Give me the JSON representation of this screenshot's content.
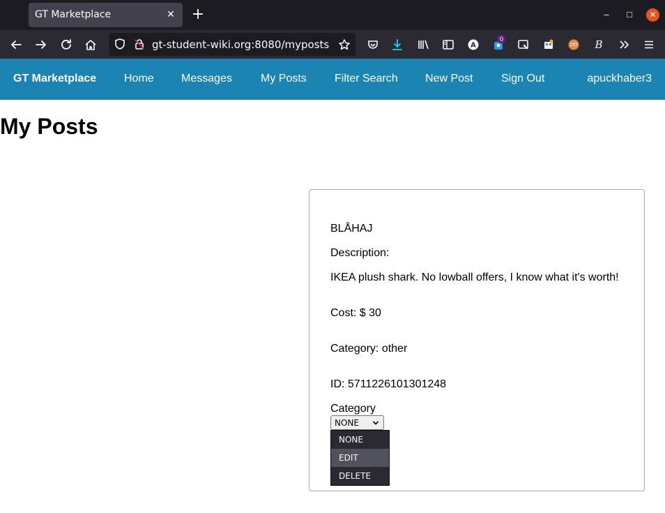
{
  "browser": {
    "tab_title": "GT Marketplace",
    "tab_close": "✕",
    "new_tab": "+",
    "url": "gt-student-wiki.org:8080/myposts",
    "extension_badge": "0",
    "window_controls": {
      "minimize": "–",
      "maximize": "□",
      "close": "✕"
    },
    "icons": [
      "back-icon",
      "forward-icon",
      "reload-icon",
      "home-icon",
      "shield-icon",
      "insecure-lock-icon",
      "bookmark-star-icon",
      "pocket-icon",
      "download-icon",
      "library-icon",
      "sidebar-icon",
      "account-icon",
      "extension-icon",
      "screenshot-icon",
      "extension-icon",
      "extension-icon",
      "extension-icon",
      "more-tools-icon",
      "menu-icon"
    ]
  },
  "site_nav": {
    "brand": "GT Marketplace",
    "links": [
      "Home",
      "Messages",
      "My Posts",
      "Filter Search",
      "New Post",
      "Sign Out"
    ],
    "user": "apuckhaber3"
  },
  "page": {
    "title": "My Posts"
  },
  "post": {
    "name": "BLÅHAJ",
    "description_label": "Description:",
    "description": "IKEA plush shark. No lowball offers, I know what it's worth!",
    "cost": "Cost: $ 30",
    "category": "Category: other",
    "id": "ID: 5711226101301248",
    "action_label": "Category",
    "select_value": "NONE",
    "options": [
      "NONE",
      "EDIT",
      "DELETE"
    ],
    "highlighted_option": "EDIT"
  },
  "colors": {
    "site_nav_bg": "#1b84b3",
    "browser_tabbar_bg": "#1c1b22",
    "browser_toolbar_bg": "#2b2a33",
    "window_close": "#e95420"
  }
}
